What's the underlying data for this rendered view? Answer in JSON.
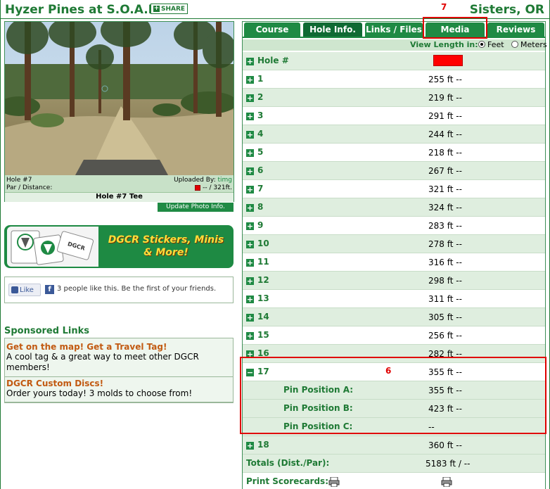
{
  "header": {
    "title": "Hyzer Pines at S.O.A.R.",
    "share_label": "SHARE",
    "location": "Sisters, OR"
  },
  "photo": {
    "hole_label": "Hole #7",
    "uploaded_by_label": "Uploaded By:",
    "uploader": "timg",
    "par_distance_label": "Par / Distance:",
    "par_distance_value": "-- / 321ft.",
    "caption": "Hole #7 Tee",
    "update_label": "Update Photo Info."
  },
  "banner": {
    "line1": "DGCR Stickers, Minis",
    "line2": "& More!"
  },
  "like": {
    "button_label": "Like",
    "fb_letter": "f",
    "text": "3 people like this. Be the first of your friends."
  },
  "sponsored": {
    "title": "Sponsored Links",
    "ads": [
      {
        "title": "Get on the map! Get a Travel Tag!",
        "desc": "A cool tag & a great way to meet other DGCR members!"
      },
      {
        "title": "DGCR Custom Discs!",
        "desc": "Order yours today! 3 molds to choose from!"
      }
    ]
  },
  "tabs": [
    "Course Info.",
    "Hole Info.",
    "Links / Files",
    "Media",
    "Reviews"
  ],
  "active_tab": "Hole Info.",
  "view_length": {
    "label": "View Length in:",
    "options": [
      "Feet",
      "Meters"
    ],
    "selected": "Feet"
  },
  "holes_header": "Hole #",
  "holes": [
    {
      "num": "1",
      "dist": "255 ft --"
    },
    {
      "num": "2",
      "dist": "219 ft --"
    },
    {
      "num": "3",
      "dist": "291 ft --"
    },
    {
      "num": "4",
      "dist": "244 ft --"
    },
    {
      "num": "5",
      "dist": "218 ft --"
    },
    {
      "num": "6",
      "dist": "267 ft --"
    },
    {
      "num": "7",
      "dist": "321 ft --"
    },
    {
      "num": "8",
      "dist": "324 ft --"
    },
    {
      "num": "9",
      "dist": "283 ft --"
    },
    {
      "num": "10",
      "dist": "278 ft --"
    },
    {
      "num": "11",
      "dist": "316 ft --"
    },
    {
      "num": "12",
      "dist": "298 ft --"
    },
    {
      "num": "13",
      "dist": "311 ft --"
    },
    {
      "num": "14",
      "dist": "305 ft --"
    },
    {
      "num": "15",
      "dist": "256 ft --"
    },
    {
      "num": "16",
      "dist": "282 ft --"
    },
    {
      "num": "17",
      "dist": "355 ft --"
    },
    {
      "num": "18",
      "dist": "360 ft --"
    }
  ],
  "pins": [
    {
      "label": "Pin Position A:",
      "dist": "355 ft --"
    },
    {
      "label": "Pin Position B:",
      "dist": "423 ft --"
    },
    {
      "label": "Pin Position C:",
      "dist": "--"
    }
  ],
  "totals": {
    "label": "Totals (Dist./Par):",
    "value": "5183 ft / --"
  },
  "print": {
    "label": "Print Scorecards:"
  },
  "annotations": {
    "media": "7",
    "hole17": "6"
  },
  "colors": {
    "brand_green": "#1f8a44",
    "annotation_red": "#e00000",
    "ad_title": "#c25a12"
  }
}
